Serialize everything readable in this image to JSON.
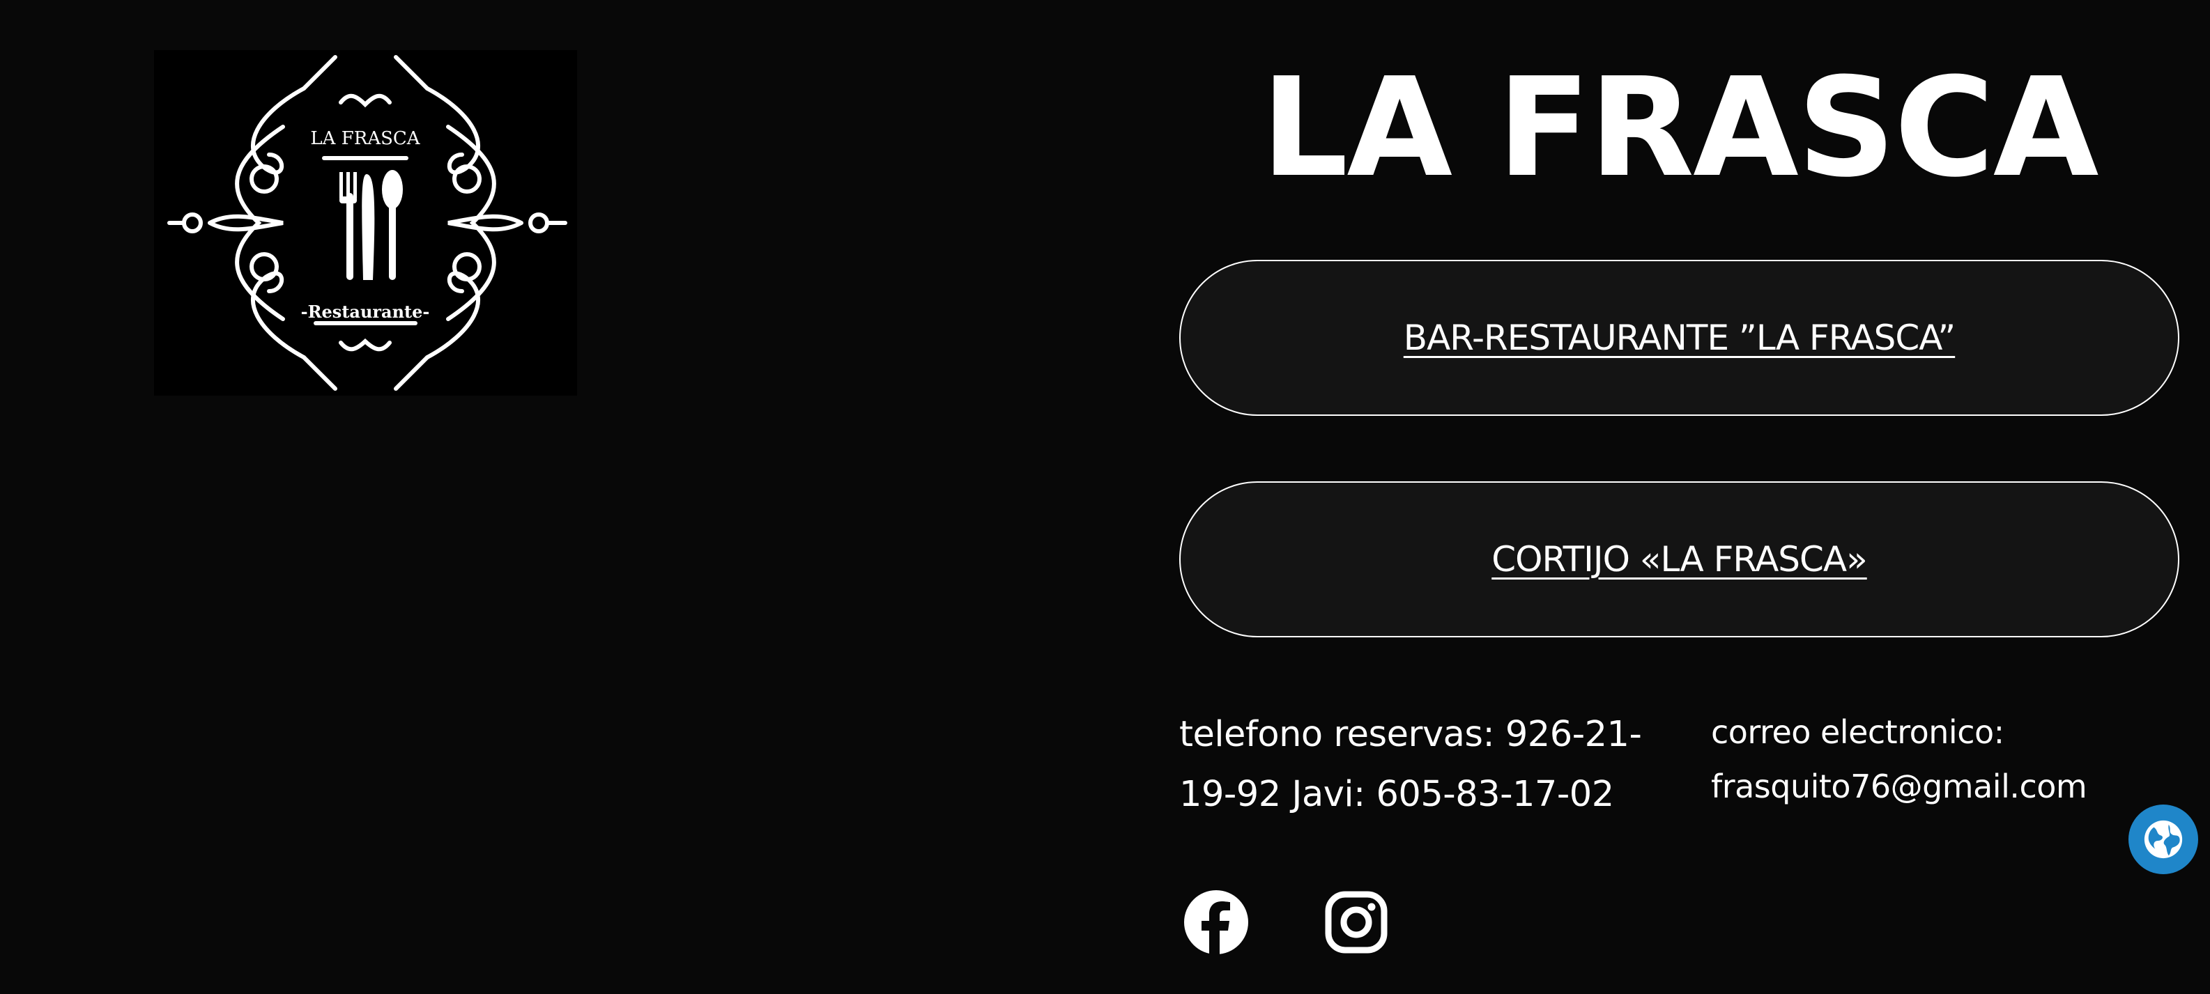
{
  "logo": {
    "name_text": "LA FRASCA",
    "subtitle_text": "-Restaurante-",
    "icon": "fork-knife-spoon-icon"
  },
  "site": {
    "title": "LA FRASCA"
  },
  "buttons": [
    {
      "label": "BAR-RESTAURANTE ”LA FRASCA”"
    },
    {
      "label": "CORTIJO «LA FRASCA»"
    }
  ],
  "contact": {
    "phone_text": "telefono reservas: 926-21-19-92 Javi: 605-83-17-02",
    "email_label": "correo electronico:",
    "email_value": "frasquito76@gmail.com"
  },
  "social": [
    {
      "icon": "facebook-icon"
    },
    {
      "icon": "instagram-icon"
    }
  ],
  "floating": {
    "icon": "globe-icon",
    "color": "#1f86c9"
  },
  "colors": {
    "background": "#080808",
    "pill_background": "#141414",
    "text": "#ffffff"
  }
}
